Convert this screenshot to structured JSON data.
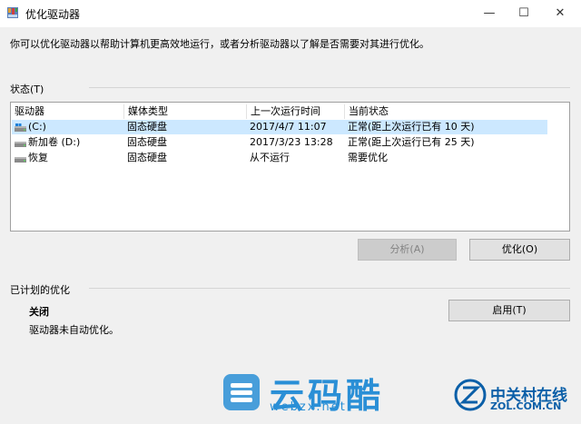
{
  "window": {
    "title": "优化驱动器",
    "minimize_glyph": "—",
    "maximize_glyph": "☐",
    "close_glyph": "✕"
  },
  "description": "你可以优化驱动器以帮助计算机更高效地运行，或者分析驱动器以了解是否需要对其进行优化。",
  "status_section": {
    "label": "状态(T)",
    "columns": [
      "驱动器",
      "媒体类型",
      "上一次运行时间",
      "当前状态"
    ],
    "rows": [
      {
        "drive": "(C:)",
        "media": "固态硬盘",
        "last_run": "2017/4/7 11:07",
        "status": "正常(距上次运行已有 10 天)",
        "icon": "system-drive-icon",
        "selected": true
      },
      {
        "drive": "新加卷 (D:)",
        "media": "固态硬盘",
        "last_run": "2017/3/23 13:28",
        "status": "正常(距上次运行已有 25 天)",
        "icon": "drive-icon",
        "selected": false
      },
      {
        "drive": "恢复",
        "media": "固态硬盘",
        "last_run": "从不运行",
        "status": "需要优化",
        "icon": "drive-icon",
        "selected": false
      }
    ],
    "analyze_button": "分析(A)",
    "optimize_button": "优化(O)"
  },
  "scheduled_section": {
    "label": "已计划的优化",
    "status": "关闭",
    "description": "驱动器未自动优化。",
    "enable_button": "启用(T)"
  },
  "watermark": {
    "site_name": "云码酷",
    "site_url": "webzx.net",
    "zol_name": "中关村在线",
    "zol_url": "ZOL.COM.CN"
  },
  "colors": {
    "selection": "#cce8ff",
    "watermark_blue": "#2a8fd6",
    "zol_blue": "#0b5fa8"
  }
}
